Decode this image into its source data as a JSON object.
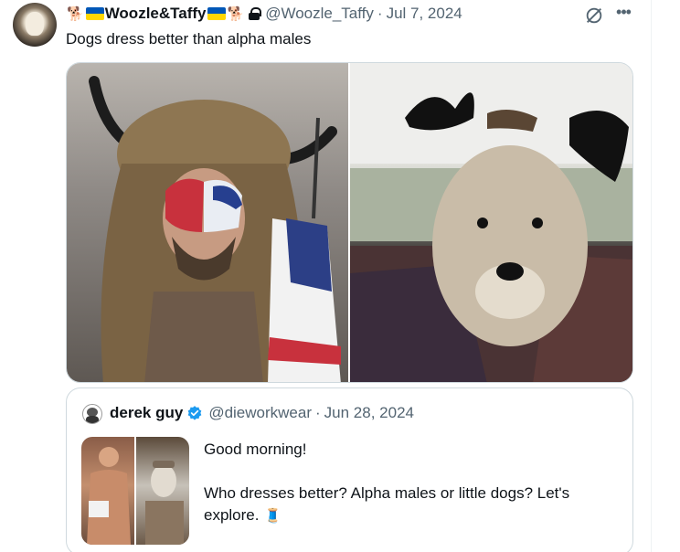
{
  "tweet": {
    "author": {
      "display_name": "Woozle&Taffy",
      "name_emoji_left": "🐕",
      "name_emoji_right": "🐕",
      "handle": "@Woozle_Taffy",
      "separator": "·",
      "date": "Jul 7, 2024"
    },
    "text": "Dogs dress better than alpha males",
    "media": [
      {
        "alt": "man-in-horned-fur-hat-with-flag",
        "icon": "photo"
      },
      {
        "alt": "terrier-with-reindeer-antlers",
        "icon": "photo"
      }
    ]
  },
  "quote": {
    "author": {
      "display_name": "derek guy",
      "handle": "@dieworkwear",
      "separator": "·",
      "date": "Jun 28, 2024"
    },
    "text_line1": "Good morning!",
    "text_line2": "Who dresses better? Alpha males or little dogs? Let's explore.",
    "text_emoji": "🧵"
  },
  "colors": {
    "text": "#0f1419",
    "muted": "#536471",
    "border": "#cfd9de",
    "verified": "#1d9bf0",
    "flag_blue": "#0057b7",
    "flag_yellow": "#ffd700"
  },
  "icons": [
    "grok-icon",
    "more-icon",
    "lock-icon",
    "verified-icon",
    "flag-icon"
  ]
}
